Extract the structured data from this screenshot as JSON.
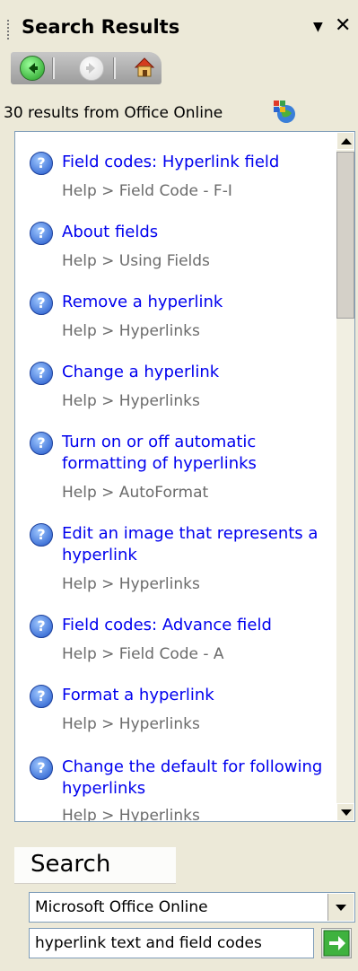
{
  "pane": {
    "title": "Search Results",
    "dropdown_icon": "▼",
    "close_icon": "✕"
  },
  "toolbar": {
    "back": "back-icon",
    "forward": "forward-icon",
    "home": "home-icon"
  },
  "results": {
    "count_text": "30 results from Office Online",
    "items": [
      {
        "title": "Field codes: Hyperlink field",
        "path": "Help > Field Code - F-I"
      },
      {
        "title": "About fields",
        "path": "Help > Using Fields"
      },
      {
        "title": "Remove a hyperlink",
        "path": "Help > Hyperlinks"
      },
      {
        "title": "Change a hyperlink",
        "path": "Help > Hyperlinks"
      },
      {
        "title": "Turn on or off automatic formatting of hyperlinks",
        "path": "Help > AutoFormat"
      },
      {
        "title": "Edit an image that represents a hyperlink",
        "path": "Help > Hyperlinks"
      },
      {
        "title": "Field codes: Advance field",
        "path": "Help > Field Code - A"
      },
      {
        "title": "Format a hyperlink",
        "path": "Help > Hyperlinks"
      },
      {
        "title": "Change the default for following hyperlinks",
        "path": "Help > Hyperlinks"
      }
    ]
  },
  "search": {
    "label": "Search",
    "scope": "Microsoft Office Online",
    "query": "hyperlink text and field codes"
  },
  "colors": {
    "link": "#0000ee",
    "path": "#6b6b6b",
    "pane_bg": "#ece9d8"
  }
}
